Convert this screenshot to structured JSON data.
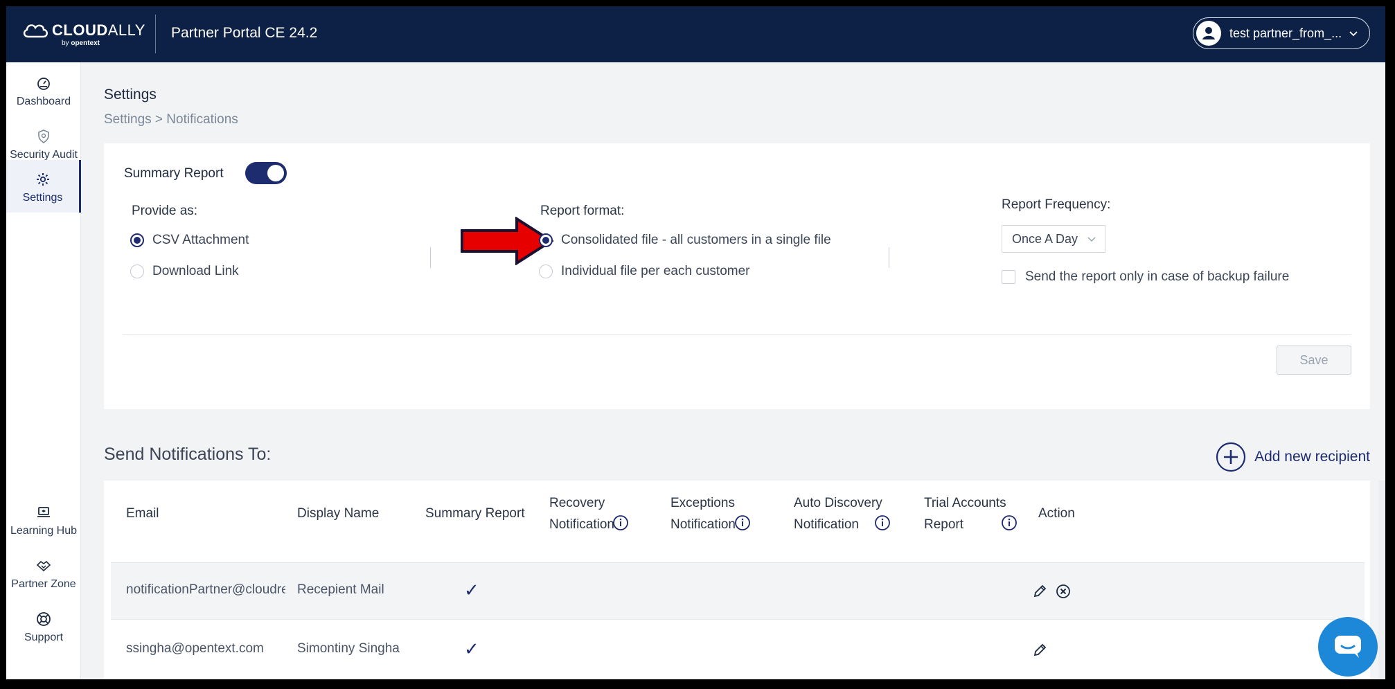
{
  "header": {
    "logo_main": "CLOUD",
    "logo_thin": "ALLY",
    "logo_sub_prefix": "by ",
    "logo_sub_brand": "opentext",
    "portal_title": "Partner Portal CE 24.2",
    "user_name": "test partner_from_..."
  },
  "sidebar": {
    "items": [
      {
        "label": "Dashboard",
        "icon": "gauge-icon"
      },
      {
        "label": "Security Audit",
        "icon": "shield-icon"
      },
      {
        "label": "Settings",
        "icon": "gear-icon",
        "active": true
      },
      {
        "label": "Learning Hub",
        "icon": "laptop-icon"
      },
      {
        "label": "Partner Zone",
        "icon": "handshake-icon"
      },
      {
        "label": "Support",
        "icon": "lifebuoy-icon"
      }
    ]
  },
  "page": {
    "title": "Settings",
    "breadcrumb": "Settings > Notifications"
  },
  "summary": {
    "label": "Summary Report",
    "toggle_on": true,
    "provide_as": {
      "heading": "Provide as:",
      "options": [
        "CSV Attachment",
        "Download Link"
      ],
      "selected": "CSV Attachment"
    },
    "report_format": {
      "heading": "Report format:",
      "options": [
        "Consolidated file - all customers in a single file",
        "Individual file per each customer"
      ],
      "selected": "Consolidated file - all customers in a single file"
    },
    "frequency": {
      "heading": "Report Frequency:",
      "value": "Once A Day",
      "checkbox_label": "Send the report only in case of backup failure",
      "checked": false
    },
    "save_label": "Save"
  },
  "notifications": {
    "title": "Send Notifications To:",
    "add_label": "Add new recipient",
    "columns": {
      "email": "Email",
      "display_name": "Display Name",
      "summary": "Summary Report",
      "recovery_1": "Recovery",
      "recovery_2": "Notification",
      "exceptions_1": "Exceptions",
      "exceptions_2": "Notification",
      "autodisc_1": "Auto Discovery",
      "autodisc_2": "Notification",
      "trial_1": "Trial Accounts",
      "trial_2": "Report",
      "action": "Action"
    },
    "rows": [
      {
        "email": "notificationPartner@cloudre...",
        "name": "Recepient Mail",
        "summary": "✓"
      },
      {
        "email": "ssingha@opentext.com",
        "name": "Simontiny Singha",
        "summary": "✓"
      }
    ]
  },
  "colors": {
    "navy": "#0c2145",
    "accent": "#1d2b6f",
    "arrow_red": "#e60000",
    "chat_blue": "#1e88d8"
  }
}
